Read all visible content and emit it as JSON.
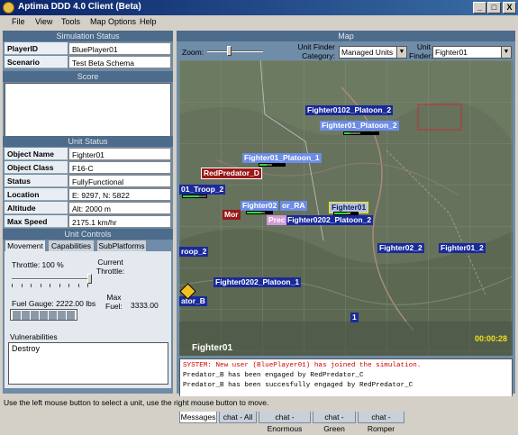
{
  "window": {
    "title": "Aptima DDD 4.0 Client (Beta)",
    "min": "_",
    "max": "□",
    "close": "X"
  },
  "menu": [
    "File",
    "View",
    "Tools",
    "Map Options",
    "Help"
  ],
  "sim_status": {
    "header": "Simulation Status",
    "player_label": "PlayerID",
    "player_value": "BluePlayer01",
    "scenario_label": "Scenario",
    "scenario_value": "Test Beta Schema"
  },
  "score": {
    "header": "Score"
  },
  "unit_status": {
    "header": "Unit Status",
    "rows": [
      {
        "label": "Object Name",
        "value": "Fighter01"
      },
      {
        "label": "Object Class",
        "value": "F16-C"
      },
      {
        "label": "Status",
        "value": "FullyFunctional"
      },
      {
        "label": "Location",
        "value": "E: 9297, N: 5822"
      },
      {
        "label": "Altitude",
        "value": "Alt: 2000 m"
      },
      {
        "label": "Max Speed",
        "value": "2175.1 km/hr"
      }
    ]
  },
  "unit_controls": {
    "header": "Unit Controls",
    "tabs": [
      "Movement",
      "Capabilities",
      "SubPlatforms"
    ],
    "throttle_label": "Throttle:  100 %",
    "current_throttle_label": "Current\nThrottle:",
    "throttle_fraction": 1.0,
    "fuel_gauge_label": "Fuel Gauge:  2222.00 lbs",
    "max_fuel_label": "Max\nFuel:",
    "max_fuel_value": "3333.00",
    "fuel_fraction": 0.667,
    "vulnerabilities_label": "Vulnerabilities",
    "vulnerabilities": [
      "Destroy"
    ]
  },
  "map": {
    "header": "Map",
    "zoom_label": "Zoom:",
    "unit_finder_category_label": "Unit Finder\nCategory:",
    "unit_finder_category_value": "Managed Units",
    "unit_finder_label": "Unit\nFinder:",
    "unit_finder_value": "Fighter01",
    "timer": "00:00:28",
    "selected_unit": "Fighter01",
    "units": [
      {
        "name": "Fighter0102_Platoon_2",
        "style": "blue"
      },
      {
        "name": "Fighter01_Platoon_2",
        "style": "light"
      },
      {
        "name": "Fighter01_Platoon_1",
        "style": "light"
      },
      {
        "name": "RedPredator_D",
        "style": "red"
      },
      {
        "name": "01_Troop_2",
        "style": "blue"
      },
      {
        "name": "Fighter02",
        "style": "light"
      },
      {
        "name": "or_RA",
        "style": "light"
      },
      {
        "name": "Fighter01",
        "style": "yellow"
      },
      {
        "name": "Mor",
        "style": "red"
      },
      {
        "name": "Fighter0202_Platoon_2",
        "style": "blue"
      },
      {
        "name": "Prec",
        "style": "light"
      },
      {
        "name": "roop_2",
        "style": "blue"
      },
      {
        "name": "Fighter02_2",
        "style": "blue"
      },
      {
        "name": "Fighter01_2",
        "style": "blue"
      },
      {
        "name": "Fighter0202_Platoon_1",
        "style": "blue"
      },
      {
        "name": "ator_B",
        "style": "blue"
      },
      {
        "name": "1",
        "style": "blue"
      }
    ]
  },
  "messages": {
    "lines": [
      {
        "text": "SYSTEM: New user (BluePlayer01) has joined the simulation.",
        "system": true
      },
      {
        "text": "Predator_B has been engaged by RedPredator_C",
        "system": false
      },
      {
        "text": "Predator_B has been succesfully engaged by RedPredator_C",
        "system": false
      }
    ],
    "tabs": [
      "Messages",
      "chat - All",
      "chat - Enormous",
      "chat - Green",
      "chat - Romper"
    ]
  },
  "statusbar": "Use the left mouse button to select a unit, use the right mouse button to move.",
  "colors": {
    "panel": "#6f8ca8",
    "header": "#4d6b8a",
    "title_start": "#0a246a",
    "system_msg": "#d00000",
    "timer": "#f0e020"
  }
}
